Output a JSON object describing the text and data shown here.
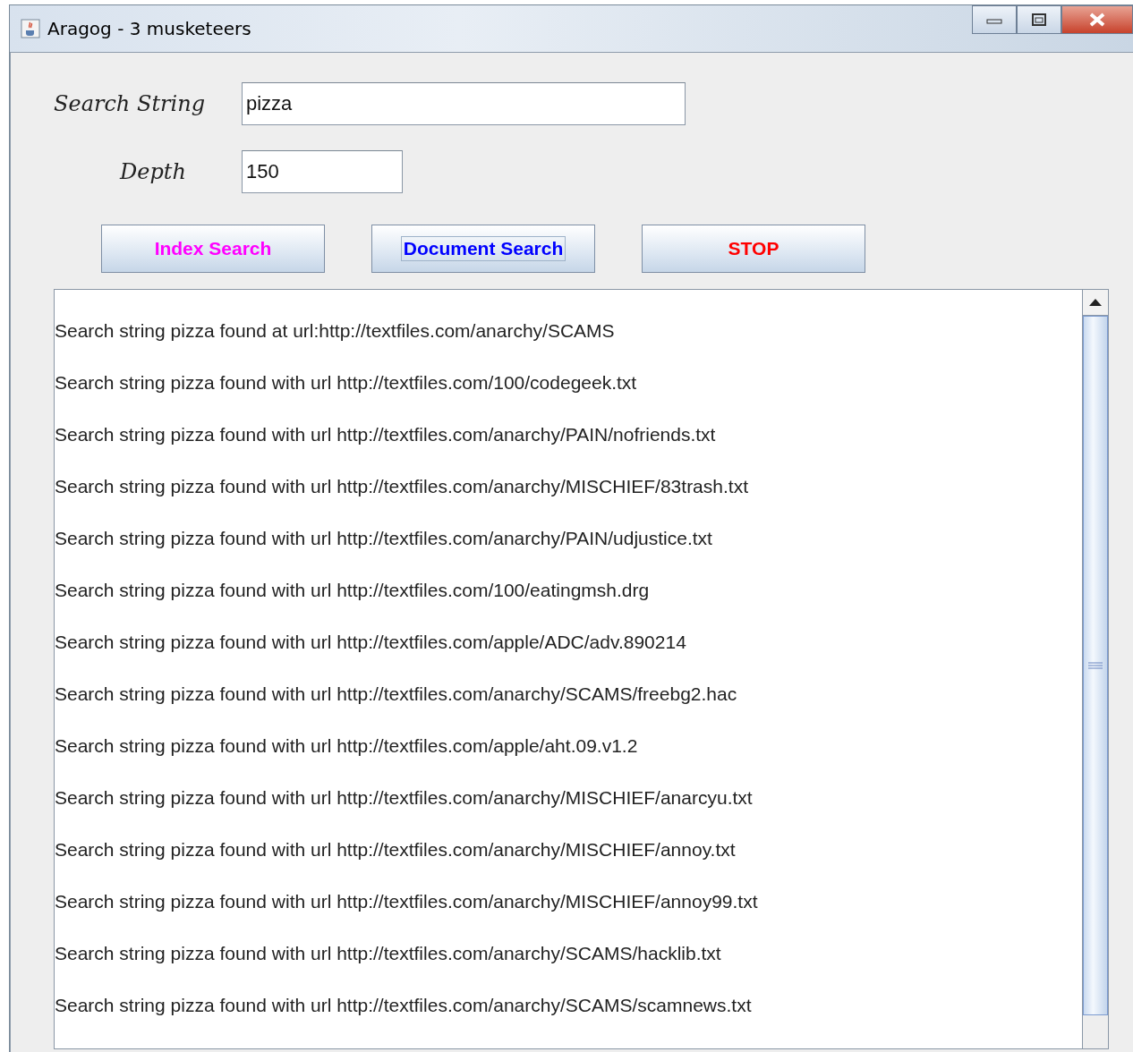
{
  "window": {
    "title": "Aragog - 3 musketeers"
  },
  "fields": [
    {
      "label": "Search String",
      "value": "pizza",
      "kind": "wide"
    },
    {
      "label": "Depth",
      "value": "150",
      "kind": "narrow"
    }
  ],
  "buttons": [
    {
      "label": "Index Search",
      "color": "#ff00ff",
      "focused": false
    },
    {
      "label": "Document Search",
      "color": "#0000ff",
      "focused": true
    },
    {
      "label": "STOP",
      "color": "#ff0000",
      "focused": false
    }
  ],
  "results": [
    "Search string pizza found at url:http://textfiles.com/anarchy/SCAMS",
    "Search string pizza found with url http://textfiles.com/100/codegeek.txt",
    "Search string pizza found with url http://textfiles.com/anarchy/PAIN/nofriends.txt",
    "Search string pizza found with url http://textfiles.com/anarchy/MISCHIEF/83trash.txt",
    "Search string pizza found with url http://textfiles.com/anarchy/PAIN/udjustice.txt",
    "Search string pizza found with url http://textfiles.com/100/eatingmsh.drg",
    "Search string pizza found with url http://textfiles.com/apple/ADC/adv.890214",
    "Search string pizza found with url http://textfiles.com/anarchy/SCAMS/freebg2.hac",
    "Search string pizza found with url http://textfiles.com/apple/aht.09.v1.2",
    "Search string pizza found with url http://textfiles.com/anarchy/MISCHIEF/anarcyu.txt",
    "Search string pizza found with url http://textfiles.com/anarchy/MISCHIEF/annoy.txt",
    "Search string pizza found with url http://textfiles.com/anarchy/MISCHIEF/annoy99.txt",
    "Search string pizza found with url http://textfiles.com/anarchy/SCAMS/hacklib.txt",
    "Search string pizza found with url http://textfiles.com/anarchy/SCAMS/scamnews.txt"
  ]
}
